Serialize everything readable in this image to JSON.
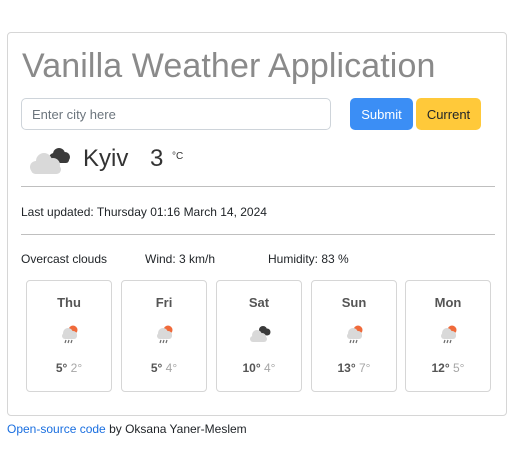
{
  "app": {
    "title": "Vanilla Weather Application"
  },
  "search": {
    "placeholder": "Enter city here",
    "value": "",
    "submit_label": "Submit",
    "current_label": "Current"
  },
  "current": {
    "icon": "overcast-clouds-icon",
    "city": "Kyiv",
    "temperature": "3",
    "unit": "°C",
    "last_updated": "Last updated: Thursday 01:16 March 14, 2024",
    "description": "Overcast clouds",
    "wind": "Wind: 3 km/h",
    "humidity": "Humidity: 83 %"
  },
  "forecast": [
    {
      "day": "Thu",
      "icon": "rain-with-sun-icon",
      "max": "5°",
      "min": "2°"
    },
    {
      "day": "Fri",
      "icon": "rain-with-sun-icon",
      "max": "5°",
      "min": "4°"
    },
    {
      "day": "Sat",
      "icon": "broken-clouds-icon",
      "max": "10°",
      "min": "4°"
    },
    {
      "day": "Sun",
      "icon": "rain-with-sun-icon",
      "max": "13°",
      "min": "7°"
    },
    {
      "day": "Mon",
      "icon": "rain-with-sun-icon",
      "max": "12°",
      "min": "5°"
    }
  ],
  "footer": {
    "link_text": "Open-source code",
    "byline": " by Oksana Yaner-Meslem"
  },
  "colors": {
    "title": "#8a8a8a",
    "submit": "#3b8ef5",
    "current": "#ffc93a",
    "link": "#1a6fe0",
    "sun": "#f06a3a"
  }
}
